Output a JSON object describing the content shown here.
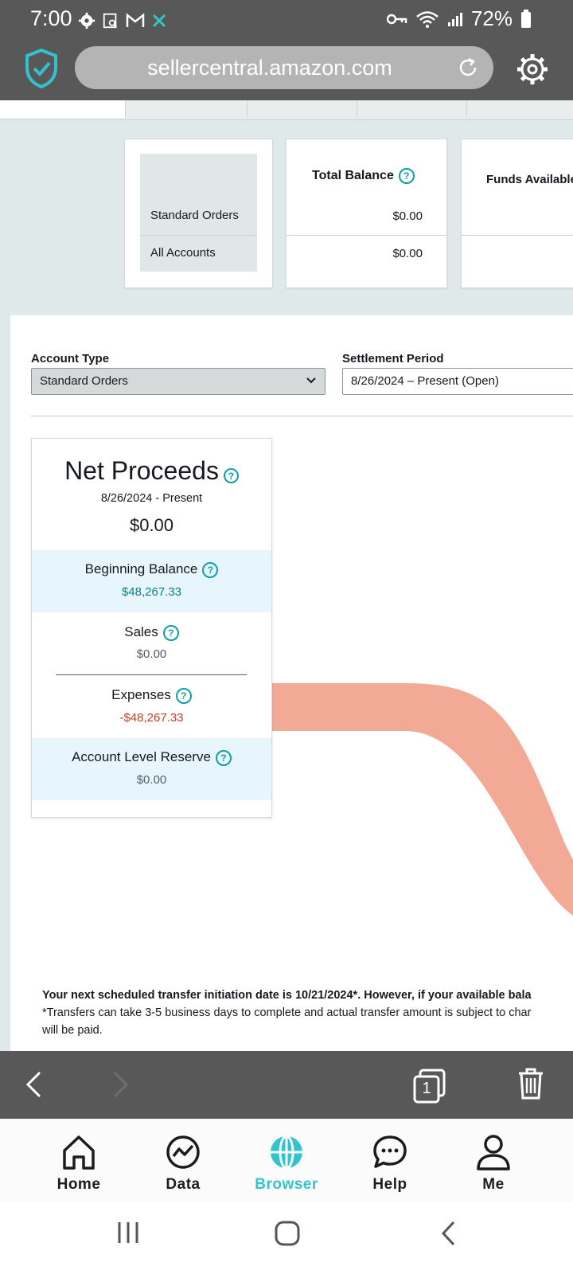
{
  "status_bar": {
    "time": "7:00",
    "battery": "72%"
  },
  "browser": {
    "url": "sellercentral.amazon.com"
  },
  "balances": {
    "total_balance_header": "Total Balance",
    "funds_available_header": "Funds Available",
    "rows": [
      {
        "label": "Standard Orders",
        "total": "$0.00"
      },
      {
        "label": "All Accounts",
        "total": "$0.00"
      }
    ]
  },
  "filters": {
    "account_type_label": "Account Type",
    "account_type_value": "Standard Orders",
    "settlement_period_label": "Settlement Period",
    "settlement_period_value": "8/26/2024 – Present (Open)"
  },
  "net_proceeds": {
    "title": "Net Proceeds",
    "period": "8/26/2024 - Present",
    "amount": "$0.00",
    "beginning_balance_label": "Beginning Balance",
    "beginning_balance_value": "$48,267.33",
    "sales_label": "Sales",
    "sales_value": "$0.00",
    "expenses_label": "Expenses",
    "expenses_value": "-$48,267.33",
    "reserve_label": "Account Level Reserve",
    "reserve_value": "$0.00"
  },
  "footer": {
    "line1": "Your next scheduled transfer initiation date is 10/21/2024*. However, if your available bala",
    "line2": "*Transfers can take 3-5 business days to complete and actual transfer amount is subject to char",
    "line3": "will be paid."
  },
  "toolbar": {
    "tab_count": "1"
  },
  "bottom_nav": [
    {
      "label": "Home",
      "icon": "home-icon"
    },
    {
      "label": "Data",
      "icon": "data-icon"
    },
    {
      "label": "Browser",
      "icon": "globe-icon"
    },
    {
      "label": "Help",
      "icon": "chat-icon"
    },
    {
      "label": "Me",
      "icon": "person-icon"
    }
  ],
  "colors": {
    "accent": "#32c3cf",
    "flow": "#f2aa97",
    "teal_text": "#087f86",
    "negative": "#c7401e"
  }
}
